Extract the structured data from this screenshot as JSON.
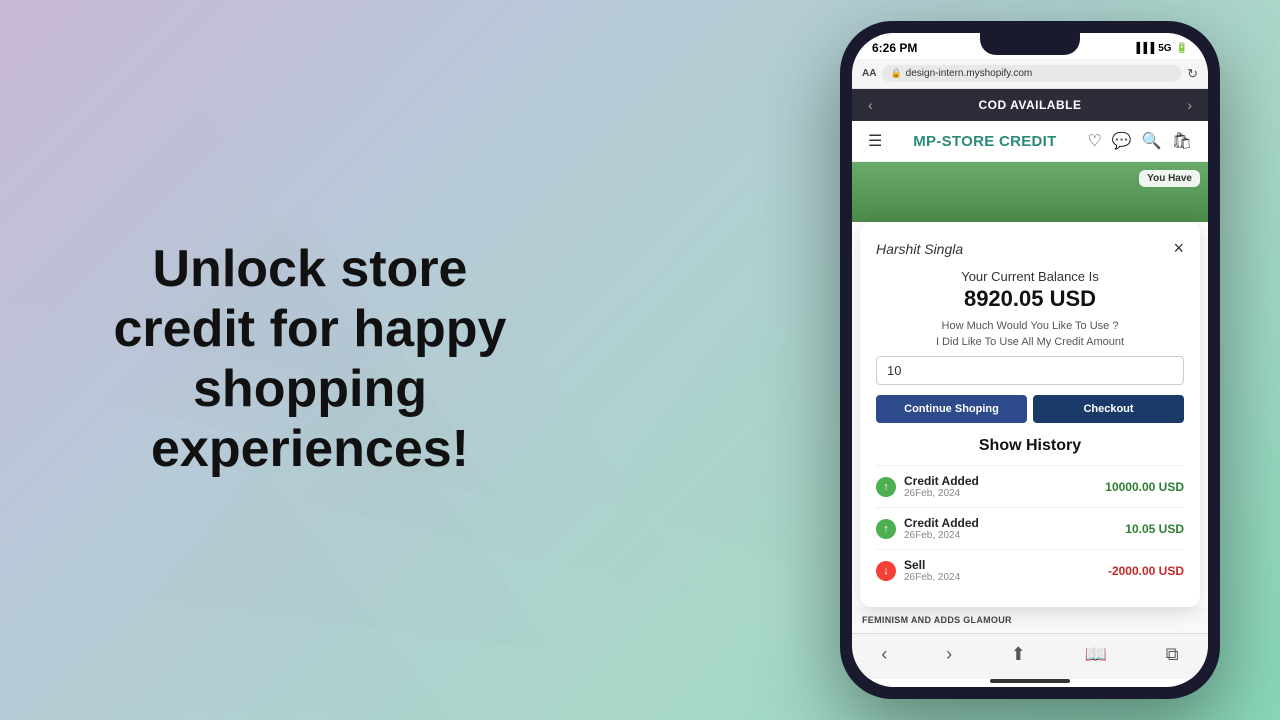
{
  "background": {
    "gradient": "linear-gradient(135deg, #c9b8d8 0%, #b8c9d8 30%, #a8d8c8 70%, #88d8b8 100%)"
  },
  "hero": {
    "text": "Unlock store credit for happy shopping experiences!"
  },
  "phone": {
    "status_bar": {
      "time": "6:26 PM",
      "signal": "5G"
    },
    "browser": {
      "aa_label": "AA",
      "url": "design-intern.myshopify.com"
    },
    "cod_bar": {
      "text": "COD AVAILABLE",
      "left_arrow": "‹",
      "right_arrow": "›"
    },
    "store_header": {
      "store_name": "MP-STORE CREDIT"
    },
    "you_have": "You Have",
    "modal": {
      "user_name": "Harshit Singla",
      "close": "×",
      "title": "Your Current Balance Is",
      "balance": "8920.05 USD",
      "question": "How Much Would You Like To Use ?",
      "use_all": "I Did Like To Use All My Credit Amount",
      "input_value": "10",
      "btn_continue": "Continue Shoping",
      "btn_checkout": "Checkout",
      "history_title": "Show History",
      "history_items": [
        {
          "type": "up",
          "label": "Credit Added",
          "date": "26Feb, 2024",
          "amount": "10000.00 USD",
          "color": "green"
        },
        {
          "type": "up",
          "label": "Credit Added",
          "date": "26Feb, 2024",
          "amount": "10.05 USD",
          "color": "green"
        },
        {
          "type": "down",
          "label": "Sell",
          "date": "26Feb, 2024",
          "amount": "-2000.00 USD",
          "color": "red"
        }
      ]
    },
    "product_bottom": "FEMINISM AND ADDS GLAMOUR"
  }
}
